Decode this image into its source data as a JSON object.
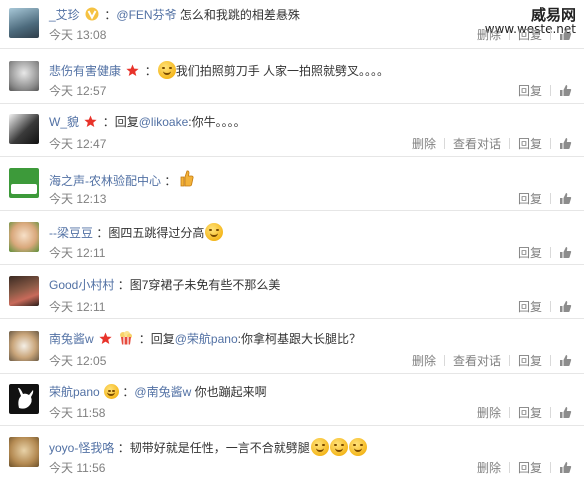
{
  "watermark": {
    "title": "威易网",
    "url": "www.weste.net"
  },
  "actions": {
    "delete": "删除",
    "view_conversation": "查看对话",
    "reply": "回复"
  },
  "comments": [
    {
      "user": "_艾珍",
      "mention": "@FEN芬爷",
      "text": " 怎么和我跳的相差悬殊",
      "prefix": "",
      "time": "今天 13:08",
      "show_delete": false,
      "show_conv": false
    },
    {
      "user": "悲伤有害健康",
      "mention": "",
      "text": "我们拍照剪刀手 人家一拍照就劈叉。。。。",
      "prefix": "",
      "time": "今天 12:57",
      "show_delete": false,
      "show_conv": false
    },
    {
      "user": "W_貌",
      "mention": "@likoake",
      "text": ":你牛。。。。",
      "prefix": "回复",
      "time": "今天 12:47",
      "show_delete": true,
      "show_conv": true
    },
    {
      "user": "海之声-农林验配中心",
      "mention": "",
      "text": "",
      "prefix": "",
      "time": "今天 12:13",
      "show_delete": false,
      "show_conv": false
    },
    {
      "user": "--梁豆豆",
      "mention": "",
      "text": "图四五跳得过分高",
      "prefix": "",
      "time": "今天 12:11",
      "show_delete": false,
      "show_conv": false
    },
    {
      "user": "Good小村村",
      "mention": "",
      "text": "图7穿裙子未免有些不那么美",
      "prefix": "",
      "time": "今天 12:11",
      "show_delete": false,
      "show_conv": false
    },
    {
      "user": "南兔酱w",
      "mention": "@荣航pano",
      "text": ":你拿柯基跟大长腿比？",
      "prefix": "回复",
      "time": "今天 12:05",
      "show_delete": true,
      "show_conv": true
    },
    {
      "user": "荣航pano",
      "mention": "@南兔酱w",
      "text": " 你也蹦起来啊",
      "prefix": "",
      "time": "今天 11:58",
      "show_delete": true,
      "show_conv": false
    },
    {
      "user": "yoyo-怪我咯",
      "mention": "",
      "text": "韧带好就是任性，一言不合就劈腿",
      "prefix": "",
      "time": "今天 11:56",
      "show_delete": true,
      "show_conv": false
    }
  ]
}
